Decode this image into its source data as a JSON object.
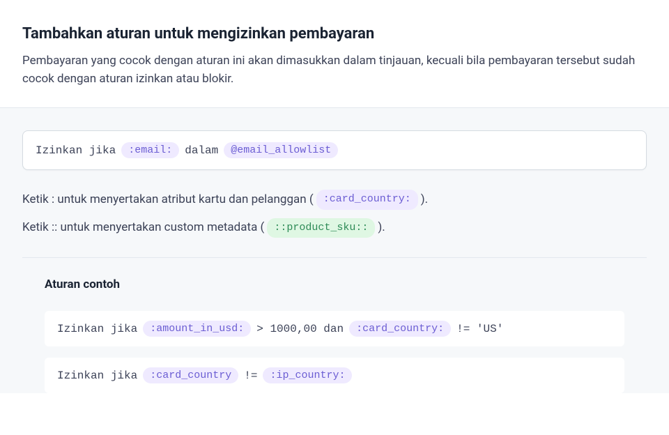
{
  "header": {
    "title": "Tambahkan aturan untuk mengizinkan pembayaran",
    "description": "Pembayaran yang cocok dengan aturan ini akan dimasukkan dalam tinjauan, kecuali bila pembayaran tersebut sudah cocok dengan aturan izinkan atau blokir."
  },
  "input": {
    "prefix": "Izinkan jika",
    "token1": ":email:",
    "middle": "dalam",
    "token2": "@email_allowlist"
  },
  "hints": {
    "line1_pre": "Ketik : untuk menyertakan atribut kartu dan pelanggan (",
    "line1_token": ":card_country:",
    "line1_post": ").",
    "line2_pre": "Ketik :: untuk menyertakan custom metadata (",
    "line2_token": "::product_sku::",
    "line2_post": ")."
  },
  "examples": {
    "title": "Aturan contoh",
    "rules": [
      {
        "prefix": "Izinkan jika",
        "token1": ":amount_in_usd:",
        "op1": "> 1000,00 dan",
        "token2": ":card_country:",
        "op2": "!= 'US'"
      },
      {
        "prefix": "Izinkan jika",
        "token1": ":card_country",
        "op1": "!=",
        "token2": ":ip_country:"
      }
    ]
  }
}
